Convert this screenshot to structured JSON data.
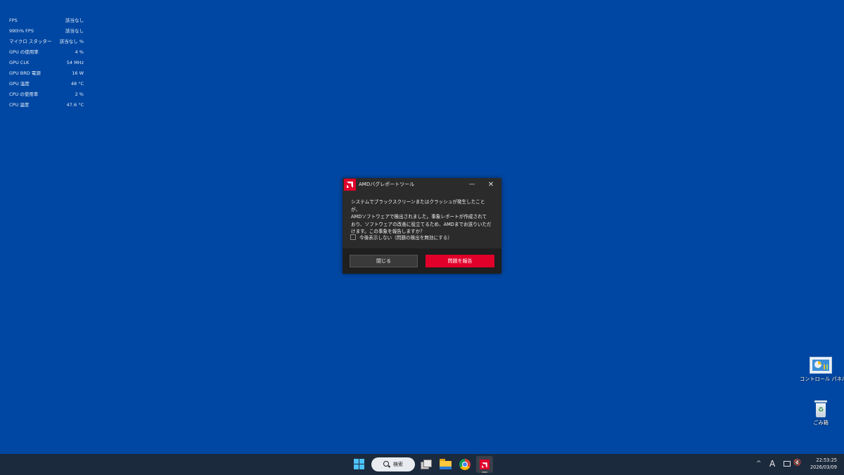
{
  "overlay": {
    "rows": [
      {
        "label": "FPS",
        "value": "該当なし"
      },
      {
        "label": "99th% FPS",
        "value": "該当なし"
      },
      {
        "label": "マイクロ スタッター",
        "value": "該当なし %"
      },
      {
        "label": "GPU の使用率",
        "value": "4 %"
      },
      {
        "label": "GPU CLK",
        "value": "54 MHz"
      },
      {
        "label": "GPU BRD 電源",
        "value": "16 W"
      },
      {
        "label": "GPU 温度",
        "value": "48 °C"
      },
      {
        "label": "CPU の使用率",
        "value": "2 %"
      },
      {
        "label": "CPU 温度",
        "value": "47.6 °C"
      }
    ]
  },
  "dialog": {
    "title": "AMDバグレポートツール",
    "minimize_glyph": "—",
    "close_glyph": "✕",
    "message": "システムでブラックスクリーンまたはクラッシュが発生したことが、\nAMDソフトウェアで検出されました。事象レポートが作成されて\nおり、ソフトウェアの改善に役立てるため、AMDまでお送りいただ\nけます。この事象を報告しますか？",
    "checkbox_label": "今後表示しない（問題の検出を無効にする）",
    "checkbox_checked": false,
    "close_button": "閉じる",
    "report_button": "問題を報告",
    "accent_color": "#e0002a"
  },
  "desktop_icons": [
    {
      "label": "コントロール パネル",
      "icon": "control-panel-icon"
    },
    {
      "label": "ごみ箱",
      "icon": "recycle-bin-icon"
    }
  ],
  "taskbar": {
    "search_label": "検索",
    "apps": [
      "start-icon",
      "search-icon",
      "task-view-icon",
      "file-explorer-icon",
      "chrome-icon",
      "amd-software-icon"
    ],
    "tray": {
      "chevron": "^",
      "ime": "A",
      "volume": "🔇"
    },
    "clock": {
      "time": "22:53:25",
      "date": "2026/03/09"
    }
  }
}
